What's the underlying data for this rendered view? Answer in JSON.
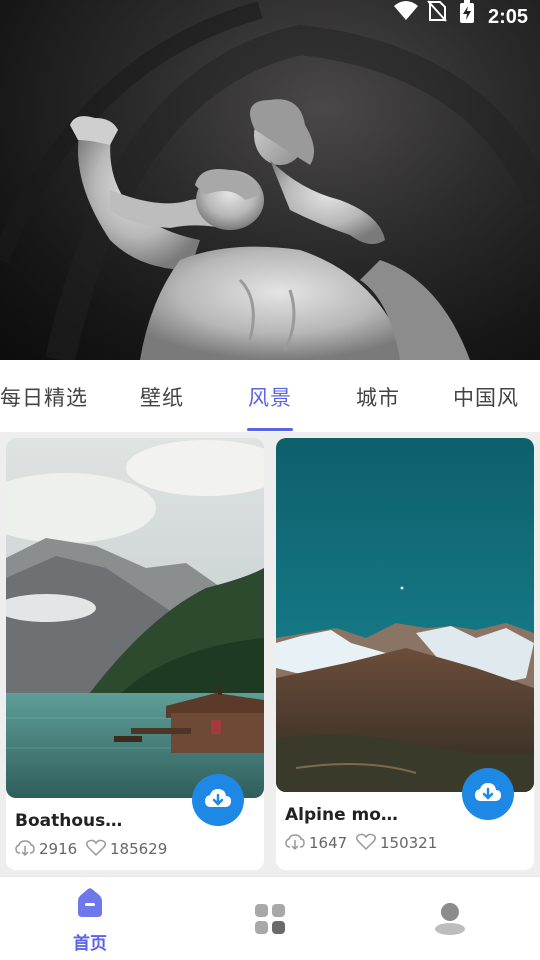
{
  "status_bar": {
    "time": "2:05",
    "icons": [
      "wifi-icon",
      "no-sim-icon",
      "battery-charging-icon"
    ]
  },
  "hero": {
    "image": "statue-banner",
    "colors": {
      "background": "#1a1a1a",
      "marble": "#c9c9c9"
    }
  },
  "tabs": {
    "items": [
      {
        "label": "每日精选"
      },
      {
        "label": "壁纸"
      },
      {
        "label": "风景"
      },
      {
        "label": "城市"
      },
      {
        "label": "中国风"
      }
    ],
    "active_index": 2,
    "accent": "#5b63e6"
  },
  "cards": [
    {
      "title": "Boathous…",
      "downloads": "2916",
      "likes": "185629",
      "image": "lake-boathouse-mountains",
      "download_icon": "cloud-download-icon"
    },
    {
      "title": "Alpine mo…",
      "downloads": "1647",
      "likes": "150321",
      "image": "alpine-snow-mountains",
      "download_icon": "cloud-download-icon"
    }
  ],
  "bottom_nav": {
    "items": [
      {
        "label": "首页",
        "icon": "home-icon",
        "active": true
      },
      {
        "label": "",
        "icon": "grid-icon",
        "active": false
      },
      {
        "label": "",
        "icon": "user-icon",
        "active": false
      }
    ],
    "accent": "#5b63e6",
    "inactive_color": "#9e9e9e"
  },
  "download_button_color": "#1e88e5"
}
